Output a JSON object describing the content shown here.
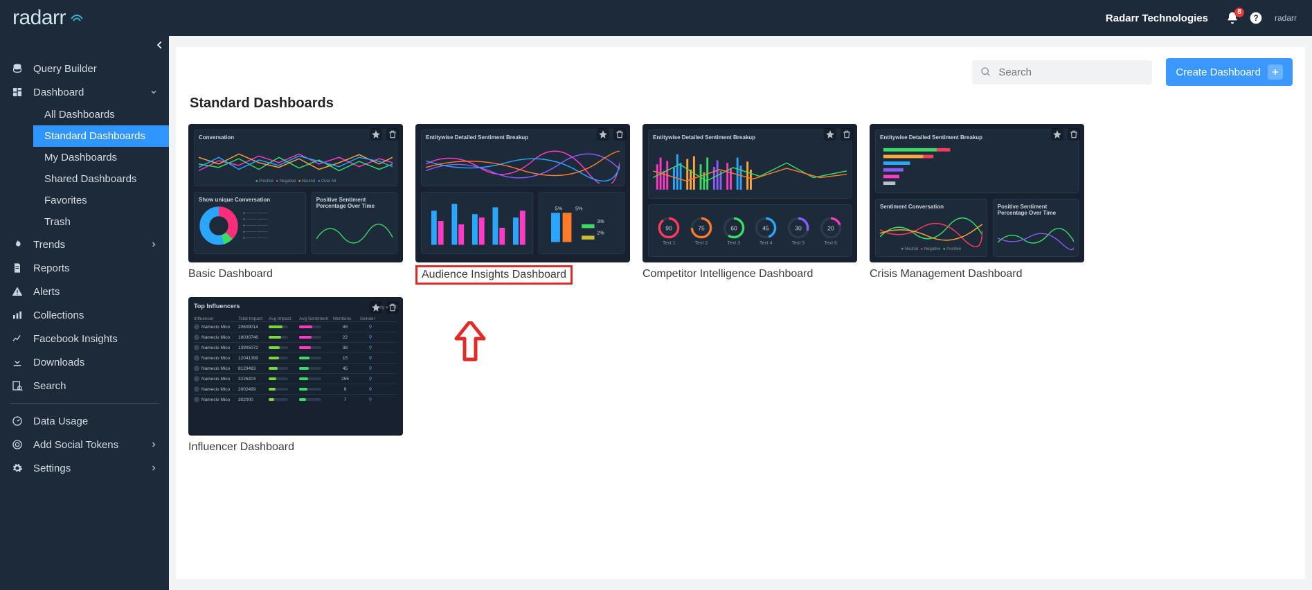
{
  "header": {
    "brand": "radarr",
    "org": "Radarr Technologies",
    "notification_count": "8",
    "brand_mini": "radarr"
  },
  "sidebar": {
    "query_builder": "Query Builder",
    "dashboard": "Dashboard",
    "dashboard_children": {
      "all": "All Dashboards",
      "standard": "Standard Dashboards",
      "my": "My Dashboards",
      "shared": "Shared Dashboards",
      "favorites": "Favorites",
      "trash": "Trash"
    },
    "trends": "Trends",
    "reports": "Reports",
    "alerts": "Alerts",
    "collections": "Collections",
    "fb_insights": "Facebook Insights",
    "downloads": "Downloads",
    "search": "Search",
    "data_usage": "Data Usage",
    "add_social": "Add Social Tokens",
    "settings": "Settings"
  },
  "toolbar": {
    "search_placeholder": "Search",
    "create_btn": "Create Dashboard"
  },
  "page": {
    "title": "Standard Dashboards"
  },
  "dashboards": [
    {
      "key": "basic",
      "title": "Basic Dashboard"
    },
    {
      "key": "audience",
      "title": "Audience Insights Dashboard",
      "highlight": true
    },
    {
      "key": "competitor",
      "title": "Competitor Intelligence Dashboard"
    },
    {
      "key": "crisis",
      "title": "Crisis Management Dashboard"
    },
    {
      "key": "influencer",
      "title": "Influencer Dashboard"
    }
  ],
  "preview": {
    "basic": {
      "top_title": "Conversation",
      "legend": [
        "Positive",
        "Negative",
        "Neutral",
        "Over All"
      ],
      "bl_title": "Show unique Conversation",
      "br_title": "Positive Sentiment Percentage Over Time"
    },
    "audience": {
      "top_title": "Entitywise Detailed Sentiment Breakup",
      "bar_labels": [
        "5%",
        "5%",
        "3%",
        "2%"
      ]
    },
    "competitor": {
      "top_title": "Entitywise Detailed Sentiment Breakup",
      "gauges": [
        {
          "v": "90",
          "label": "Text 1",
          "color": "#ff3b5c"
        },
        {
          "v": "75",
          "label": "Text 2",
          "color": "#ff7a29"
        },
        {
          "v": "60",
          "label": "Text 3",
          "color": "#3cdc64"
        },
        {
          "v": "45",
          "label": "Text 4",
          "color": "#2aa6ff"
        },
        {
          "v": "30",
          "label": "Text 5",
          "color": "#8a5bff"
        },
        {
          "v": "20",
          "label": "Text 6",
          "color": "#ff3bc5"
        }
      ]
    },
    "crisis": {
      "top_title": "Entitywise Detailed Sentiment Breakup",
      "bl_title": "Sentiment Conversation",
      "br_title": "Positive Sentiment Percentage Over Time",
      "legend": [
        "Neutral",
        "Negative",
        "Positive"
      ]
    },
    "influencer": {
      "title": "Top Influencers",
      "filters": [
        "Daily",
        "All"
      ],
      "cols": [
        "Influencer",
        "Total Impact",
        "Avg Impact",
        "Avg Sentiment",
        "Mentions",
        "Gender"
      ],
      "rows": [
        {
          "name": "Namecio Mico",
          "impact": "20609014",
          "mentions": "45"
        },
        {
          "name": "Namecio Mico",
          "impact": "18030746",
          "mentions": "22"
        },
        {
          "name": "Namecio Mico",
          "impact": "13905072",
          "mentions": "38"
        },
        {
          "name": "Namecio Mico",
          "impact": "12041399",
          "mentions": "15"
        },
        {
          "name": "Namecio Mico",
          "impact": "8129483",
          "mentions": "45"
        },
        {
          "name": "Namecio Mico",
          "impact": "3226403",
          "mentions": "255"
        },
        {
          "name": "Namecio Mico",
          "impact": "2002489",
          "mentions": "9"
        },
        {
          "name": "Namecio Mico",
          "impact": "302000",
          "mentions": "7"
        }
      ]
    }
  }
}
